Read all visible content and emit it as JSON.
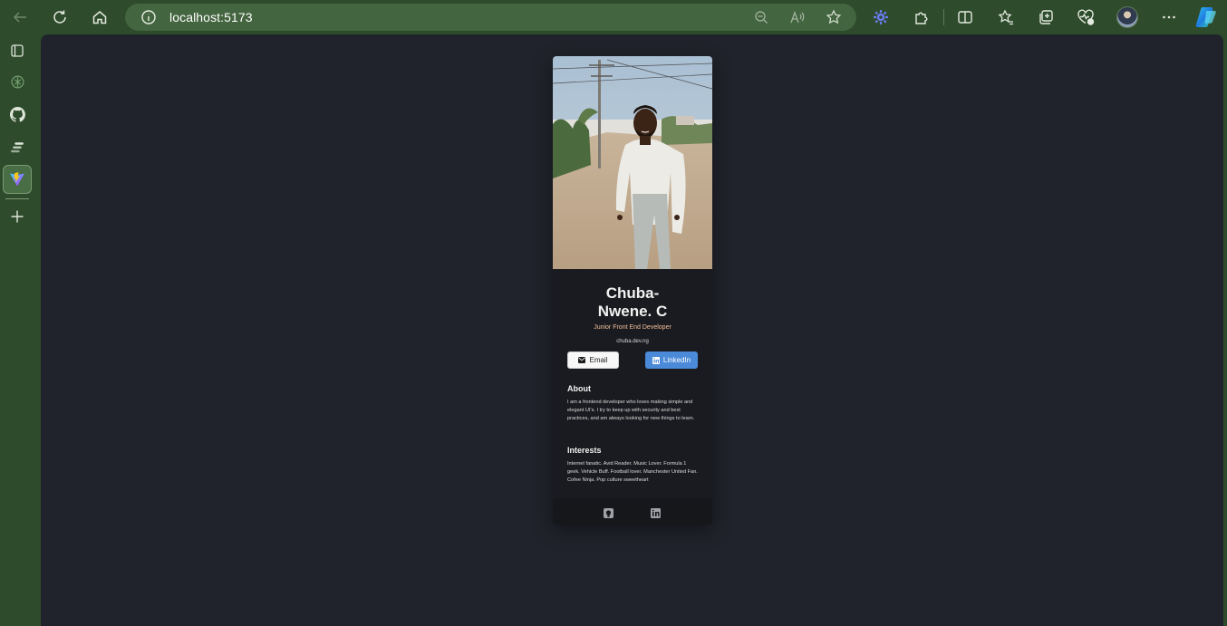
{
  "browser": {
    "url": "localhost:5173",
    "icons": {
      "back": "arrow-left-icon",
      "refresh": "refresh-icon",
      "home": "home-icon",
      "site_info": "info-icon",
      "zoom": "zoom-out-icon",
      "read_aloud": "read-aloud-icon",
      "favorite": "star-icon",
      "extension": "extension-gear-icon",
      "extensions": "puzzle-icon",
      "split_screen": "split-screen-icon",
      "favorites": "favorites-icon",
      "collections": "collections-icon",
      "performance": "heart-pulse-icon",
      "profile": "avatar",
      "more": "more-icon",
      "copilot": "copilot-icon"
    }
  },
  "sidebar": {
    "items": [
      {
        "name": "tab-actions-icon"
      },
      {
        "name": "chatgpt-icon"
      },
      {
        "name": "github-icon"
      },
      {
        "name": "app-icon"
      },
      {
        "name": "vite-icon"
      },
      {
        "name": "add-icon"
      }
    ]
  },
  "profile": {
    "name_line1": "Chuba-",
    "name_line2": "Nwene. C",
    "role": "Junior Front End Developer",
    "website": "chuba.dev.ng",
    "email_label": "Email",
    "linkedin_label": "LinkedIn",
    "about_title": "About",
    "about_text": "I am a frontend developer who loves making simple and elegant UI's. I try to keep up with security and best practices, and am always looking for new things to learn.",
    "interests_title": "Interests",
    "interests_text": "Internet fanatic. Avid Reader. Music Lover. Formula 1 geek. Vehicle Buff. Football lover. Manchester United Fan. Cofee Ninja. Pop culture sweetheart"
  },
  "colors": {
    "browser_chrome": "#2e4b2c",
    "page_bg": "#21232c",
    "card_bg": "#1a1b20",
    "role_accent": "#f3bf99",
    "linkedin_blue": "#4a8ad8"
  }
}
